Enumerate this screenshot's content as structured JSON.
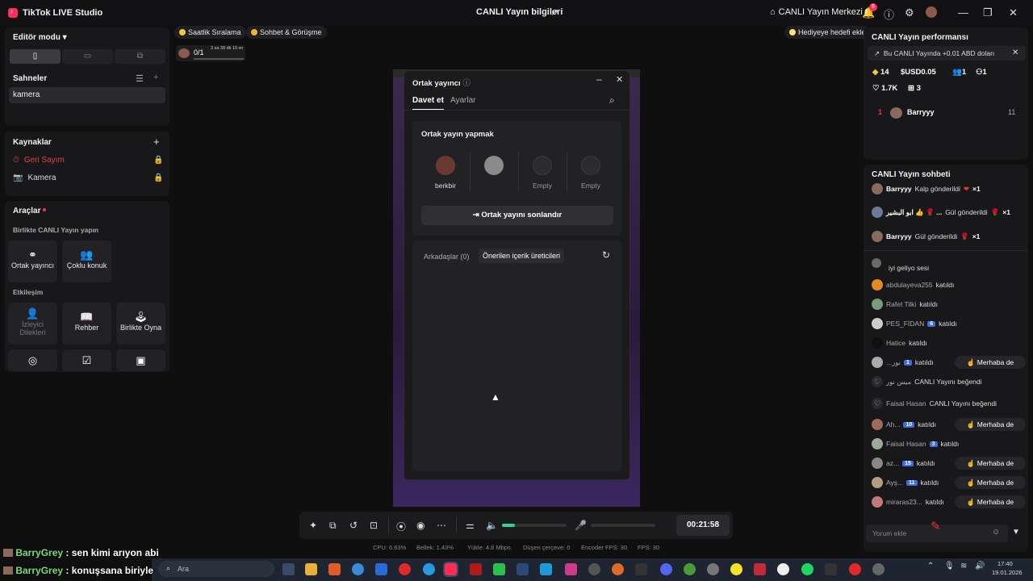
{
  "app": {
    "title": "TikTok LIVE Studio",
    "center_title": "CANLI Yayın bilgileri",
    "center_link": "CANLI Yayın Merkezi",
    "notif_count": "6"
  },
  "editor": {
    "mode_label": "Editör modu",
    "scenes_title": "Sahneler",
    "scene_item": "kamera",
    "sources_title": "Kaynaklar",
    "sources": [
      "Geri Sayım",
      "Kamera"
    ],
    "tools_title": "Araçlar",
    "together_title": "Birlikte CANLI Yayın yapın",
    "tools_row1": [
      "Ortak yayıncı",
      "Çoklu konuk"
    ],
    "interaction_title": "Etkileşim",
    "tools_row2": [
      "İzleyici Dilekleri",
      "Rehber",
      "Birlikte Oyna"
    ]
  },
  "chips": {
    "hourly": "Saatlik Sıralama",
    "chat": "Sohbet & Görüşme",
    "gift_goal": "Hediyeye hedefi ekle",
    "goal_count": "0/1",
    "goal_time": "3 sa 38 dk 10 sn"
  },
  "modal": {
    "title": "Ortak yayıncı",
    "tabs": [
      "Davet et",
      "Ayarlar"
    ],
    "section_title": "Ortak yayın yapmak",
    "slots": [
      "berkbir",
      "",
      "Empty",
      "Empty"
    ],
    "end_button": "Ortak yayını sonlandır",
    "subtabs": [
      "Arkadaşlar (0)",
      "Önerilen içerik üreticileri"
    ]
  },
  "perf": {
    "title": "CANLI Yayın performansı",
    "earning": "Bu CANLI Yayında +0.01 ABD doları",
    "stats": [
      "14",
      "USD0.05",
      "1",
      "1",
      "1.7K",
      "3"
    ],
    "rank_no": "1",
    "rank_name": "Barryyy",
    "rank_value": "11"
  },
  "chat": {
    "title": "CANLI Yayın sohbeti",
    "gifts": [
      {
        "name": "Barryyy",
        "text": "Kalp gönderildi",
        "emoji": "❤",
        "count": "×1"
      },
      {
        "name": "ابو البشير 👍 🌹 ...",
        "text": "Gül gönderildi",
        "emoji": "🌹",
        "count": "×1"
      },
      {
        "name": "Barryyy",
        "text": "Gül gönderildi",
        "emoji": "🌹",
        "count": "×1"
      }
    ],
    "messages": [
      {
        "name": "",
        "text": "iyi geliyo sesi"
      },
      {
        "name": "abdulayeva255",
        "text": "katıldı"
      },
      {
        "name": "Rafet Tilki",
        "text": "katıldı"
      },
      {
        "name": "PES_FİDAN",
        "level": "6",
        "text": "katıldı"
      },
      {
        "name": "Hatice",
        "text": "katıldı"
      },
      {
        "name": "...نور",
        "level": "1",
        "text": "katıldı",
        "hello": "Merhaba de"
      },
      {
        "name": "ميس نور",
        "text": "CANLI Yayını beğendi"
      },
      {
        "name": "Faisal Hasan",
        "text": "CANLI Yayını beğendi"
      },
      {
        "name": "Ah...",
        "level": "10",
        "text": "katıldı",
        "hello": "Merhaba de"
      },
      {
        "name": "Faisal Hasan",
        "level": "3",
        "text": "katıldı"
      },
      {
        "name": "az...",
        "level": "15",
        "text": "katıldı",
        "hello": "Merhaba de"
      },
      {
        "name": "Ayş...",
        "level": "11",
        "text": "katıldı",
        "hello": "Merhaba de"
      },
      {
        "name": "miraras23...",
        "text": "katıldı",
        "hello": "Merhaba de"
      }
    ],
    "input_placeholder": "Yorum ekle"
  },
  "controls": {
    "timer": "00:21:58",
    "volume_fraction": 0.2
  },
  "stats": {
    "cpu": "CPU: 6.63%",
    "mem": "Bellek: 1.43%",
    "upload": "Yükle: 4.8 Mbps",
    "dropped": "Düşen çerçeve: 0",
    "encoder": "Encoder FPS: 30",
    "fps": "FPS: 30"
  },
  "overlay": [
    {
      "name": "BarryGrey",
      "text": ": sen kimi arıyon abi"
    },
    {
      "name": "BarryGrey",
      "text": ": konuşsana biriyle"
    }
  ],
  "taskbar": {
    "search": "Ara",
    "time": "17:40",
    "date": "19.01.2026"
  },
  "colors": {
    "accent_red": "#ff2d55",
    "accent_green": "#2bd69b",
    "level_blue": "#3d6ee0"
  }
}
